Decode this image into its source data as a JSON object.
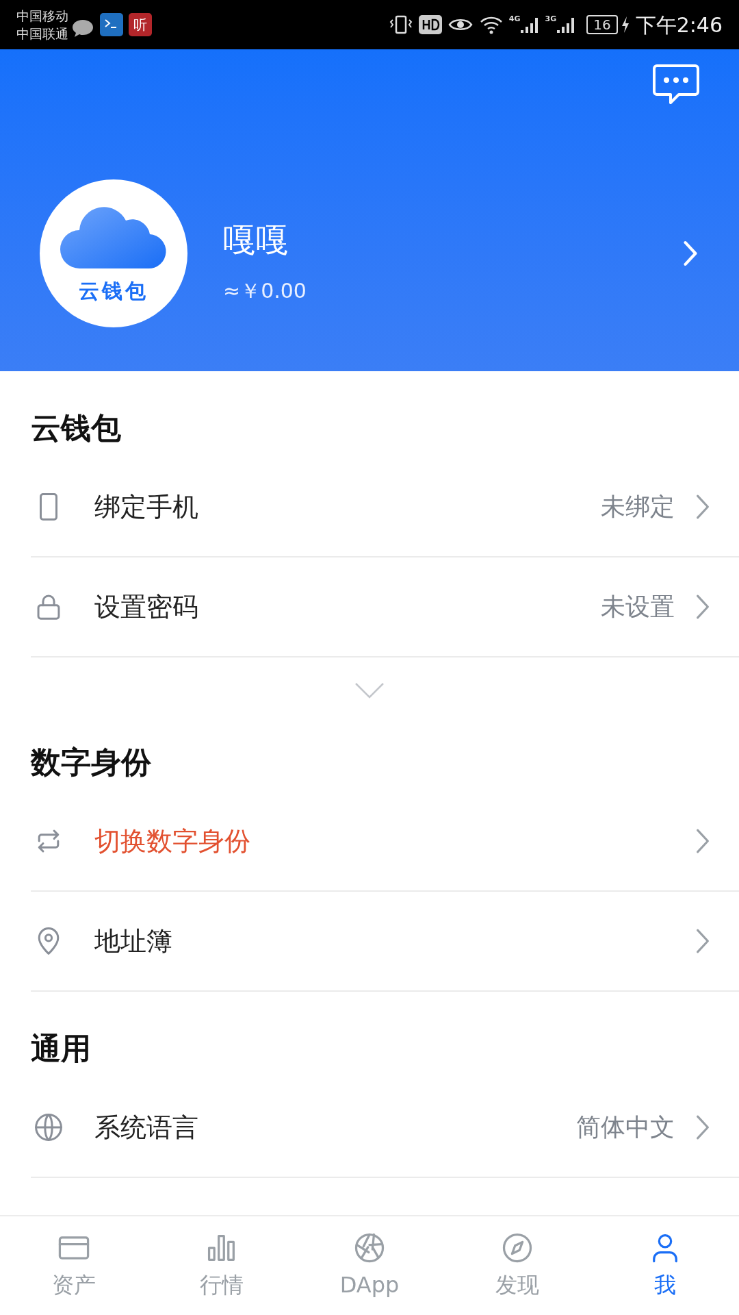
{
  "status_bar": {
    "carriers": [
      "中国移动",
      "中国联通"
    ],
    "app_badge": "听",
    "network_labels": [
      "4G",
      "3G"
    ],
    "battery": "16",
    "time": "下午2:46"
  },
  "profile": {
    "name": "嘎嘎",
    "balance": "≈￥0.00",
    "avatar_label": "云钱包"
  },
  "sections": [
    {
      "title": "云钱包",
      "rows": [
        {
          "kind": "phone",
          "label": "绑定手机",
          "value": "未绑定",
          "highlight": false
        },
        {
          "kind": "lock",
          "label": "设置密码",
          "value": "未设置",
          "highlight": false
        }
      ],
      "collapsible": true
    },
    {
      "title": "数字身份",
      "rows": [
        {
          "kind": "switch",
          "label": "切换数字身份",
          "highlight": true
        },
        {
          "kind": "pin",
          "label": "地址簿",
          "highlight": false
        }
      ]
    },
    {
      "title": "通用",
      "rows": [
        {
          "kind": "globe",
          "label": "系统语言",
          "value": "简体中文",
          "highlight": false
        }
      ]
    }
  ],
  "tabs": [
    {
      "kind": "card",
      "label": "资产",
      "selected": false
    },
    {
      "kind": "bars",
      "label": "行情",
      "selected": false
    },
    {
      "kind": "aperture",
      "label": "DApp",
      "selected": false
    },
    {
      "kind": "compass",
      "label": "发现",
      "selected": false
    },
    {
      "kind": "person",
      "label": "我",
      "selected": true
    }
  ]
}
